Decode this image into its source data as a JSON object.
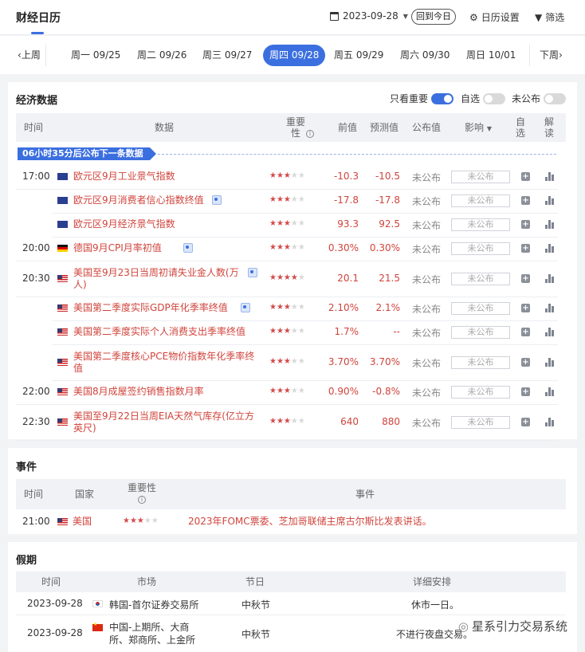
{
  "header": {
    "title": "财经日历",
    "date": "2023-09-28",
    "today_label": "回到今日",
    "settings_label": "日历设置",
    "filter_label": "筛选"
  },
  "week": {
    "prev_label": "上周",
    "next_label": "下周",
    "days": [
      "周一 09/25",
      "周二 09/26",
      "周三 09/27",
      "周四 09/28",
      "周五 09/29",
      "周六 09/30",
      "周日 10/01"
    ],
    "active_index": 3
  },
  "econ": {
    "title": "经济数据",
    "toggles": [
      {
        "label": "只看重要",
        "on": true
      },
      {
        "label": "自选",
        "on": false
      },
      {
        "label": "未公布",
        "on": false
      }
    ],
    "columns": {
      "time": "时间",
      "data": "数据",
      "importance": "重要性",
      "prev": "前值",
      "forecast": "预测值",
      "actual": "公布值",
      "impact": "影响",
      "watch": "自选",
      "interpret": "解读"
    },
    "notice": "06小时35分后公布下一条数据",
    "rows": [
      {
        "time": "17:00",
        "flag": "eu",
        "name": "欧元区9月工业景气指数",
        "att": false,
        "stars": 3,
        "prev": "-10.3",
        "forecast": "-10.5",
        "actual": "未公布",
        "impact": "未公布"
      },
      {
        "time": "",
        "flag": "eu",
        "name": "欧元区9月消费者信心指数终值",
        "att": true,
        "stars": 3,
        "prev": "-17.8",
        "forecast": "-17.8",
        "actual": "未公布",
        "impact": "未公布"
      },
      {
        "time": "",
        "flag": "eu",
        "name": "欧元区9月经济景气指数",
        "att": false,
        "stars": 3,
        "prev": "93.3",
        "forecast": "92.5",
        "actual": "未公布",
        "impact": "未公布"
      },
      {
        "time": "20:00",
        "flag": "de",
        "name": "德国9月CPI月率初值",
        "att": true,
        "stars": 3,
        "prev": "0.30%",
        "forecast": "0.30%",
        "actual": "未公布",
        "impact": "未公布"
      },
      {
        "time": "20:30",
        "flag": "us",
        "name": "美国至9月23日当周初请失业金人数(万",
        "name2": "人)",
        "att": true,
        "stars": 4,
        "prev": "20.1",
        "forecast": "21.5",
        "actual": "未公布",
        "impact": "未公布"
      },
      {
        "time": "",
        "flag": "us",
        "name": "美国第二季度实际GDP年化季率终值",
        "att": true,
        "stars": 3,
        "prev": "2.10%",
        "forecast": "2.1%",
        "actual": "未公布",
        "impact": "未公布"
      },
      {
        "time": "",
        "flag": "us",
        "name": "美国第二季度实际个人消费支出季率终值",
        "att": false,
        "stars": 3,
        "prev": "1.7%",
        "forecast": "--",
        "actual": "未公布",
        "impact": "未公布"
      },
      {
        "time": "",
        "flag": "us",
        "name": "美国第二季度核心PCE物价指数年化季率终",
        "name2": "值",
        "att": false,
        "stars": 3,
        "prev": "3.70%",
        "forecast": "3.70%",
        "actual": "未公布",
        "impact": "未公布"
      },
      {
        "time": "22:00",
        "flag": "us",
        "name": "美国8月成屋签约销售指数月率",
        "att": false,
        "stars": 3,
        "prev": "0.90%",
        "forecast": "-0.8%",
        "actual": "未公布",
        "impact": "未公布"
      },
      {
        "time": "22:30",
        "flag": "us",
        "name": "美国至9月22日当周EIA天然气库存(亿立方",
        "name2": "英尺)",
        "att": false,
        "stars": 3,
        "prev": "640",
        "forecast": "880",
        "actual": "未公布",
        "impact": "未公布"
      }
    ]
  },
  "events": {
    "title": "事件",
    "columns": {
      "time": "时间",
      "country": "国家",
      "importance": "重要性",
      "event": "事件"
    },
    "rows": [
      {
        "time": "21:00",
        "flag": "us",
        "country": "美国",
        "stars": 3,
        "event": "2023年FOMC票委、芝加哥联储主席古尔斯比发表讲话。"
      }
    ]
  },
  "holidays": {
    "title": "假期",
    "columns": {
      "time": "时间",
      "market": "市场",
      "holiday": "节日",
      "detail": "详细安排"
    },
    "rows": [
      {
        "time": "2023-09-28",
        "flag": "kr",
        "market": "韩国-首尔证券交易所",
        "holiday": "中秋节",
        "detail": "休市一日。"
      },
      {
        "time": "2023-09-28",
        "flag": "cn",
        "market": "中国-上期所、大商",
        "market2": "所、郑商所、上金所",
        "holiday": "中秋节",
        "detail": "不进行夜盘交易。"
      }
    ]
  },
  "watermark": "星系引力交易系统"
}
